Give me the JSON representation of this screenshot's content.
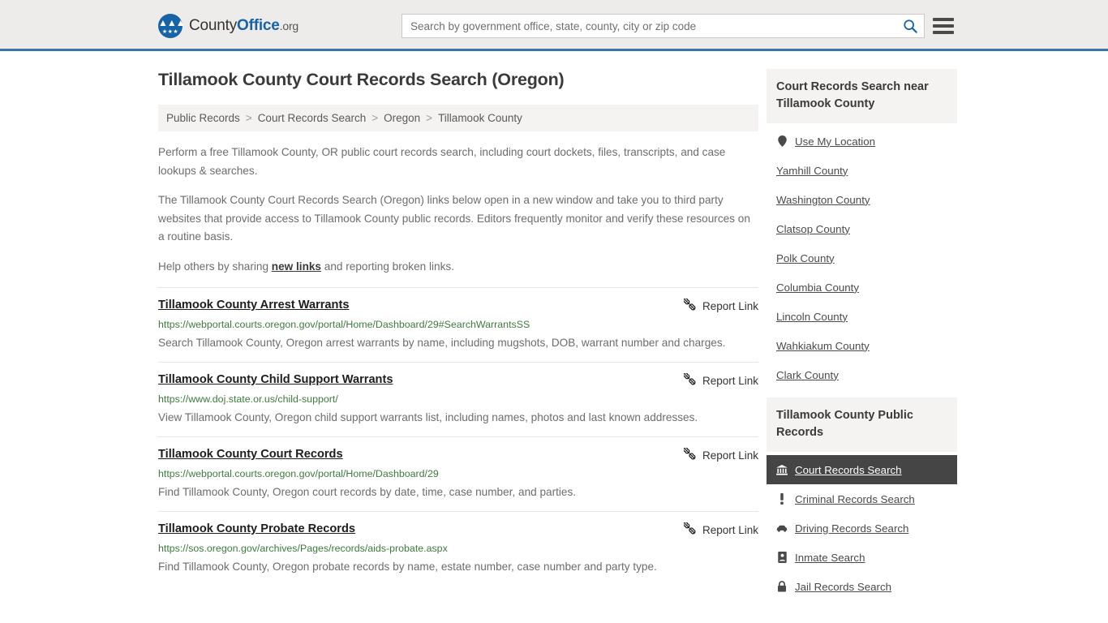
{
  "header": {
    "brand": {
      "part1": "County",
      "part2": "Office",
      "tld": ".org",
      "logo_icon": "eagle-seal-icon"
    },
    "search": {
      "placeholder": "Search by government office, state, county, city or zip code",
      "value": ""
    },
    "search_button_icon": "search-icon",
    "menu_button_icon": "hamburger-menu-icon",
    "accent_color": "#1763a8",
    "border_color": "#3a76a8"
  },
  "page_title": "Tillamook County Court Records Search (Oregon)",
  "breadcrumb": [
    "Public Records",
    "Court Records Search",
    "Oregon",
    "Tillamook County"
  ],
  "breadcrumb_separator": ">",
  "intro": {
    "p1": "Perform a free Tillamook County, OR public court records search, including court dockets, files, transcripts, and case lookups & searches.",
    "p2": "The Tillamook County Court Records Search (Oregon) links below open in a new window and take you to third party websites that provide access to Tillamook County public records. Editors frequently monitor and verify these resources on a routine basis.",
    "p3_before": "Help others by sharing ",
    "p3_link": "new links",
    "p3_after": " and reporting broken links."
  },
  "report_link_label": "Report Link",
  "report_link_icon": "broken-link-icon",
  "results": [
    {
      "title": "Tillamook County Arrest Warrants",
      "url": "https://webportal.courts.oregon.gov/portal/Home/Dashboard/29#SearchWarrantsSS",
      "description": "Search Tillamook County, Oregon arrest warrants by name, including mugshots, DOB, warrant number and charges."
    },
    {
      "title": "Tillamook County Child Support Warrants",
      "url": "https://www.doj.state.or.us/child-support/",
      "description": "View Tillamook County, Oregon child support warrants list, including names, photos and last known addresses."
    },
    {
      "title": "Tillamook County Court Records",
      "url": "https://webportal.courts.oregon.gov/portal/Home/Dashboard/29",
      "description": "Find Tillamook County, Oregon court records by date, time, case number, and parties."
    },
    {
      "title": "Tillamook County Probate Records",
      "url": "https://sos.oregon.gov/archives/Pages/records/aids-probate.aspx",
      "description": "Find Tillamook County, Oregon probate records by name, estate number, case number and party type."
    }
  ],
  "sidebar": {
    "nearby": {
      "heading": "Court Records Search near Tillamook County",
      "items": [
        {
          "label": "Use My Location",
          "icon": "map-pin-icon"
        },
        {
          "label": "Yamhill County",
          "icon": ""
        },
        {
          "label": "Washington County",
          "icon": ""
        },
        {
          "label": "Clatsop County",
          "icon": ""
        },
        {
          "label": "Polk County",
          "icon": ""
        },
        {
          "label": "Columbia County",
          "icon": ""
        },
        {
          "label": "Lincoln County",
          "icon": ""
        },
        {
          "label": "Wahkiakum County",
          "icon": ""
        },
        {
          "label": "Clark County",
          "icon": ""
        }
      ]
    },
    "public_records": {
      "heading": "Tillamook County Public Records",
      "items": [
        {
          "label": "Court Records Search",
          "icon": "courthouse-icon",
          "active": true
        },
        {
          "label": "Criminal Records Search",
          "icon": "exclamation-icon",
          "active": false
        },
        {
          "label": "Driving Records Search",
          "icon": "car-icon",
          "active": false
        },
        {
          "label": "Inmate Search",
          "icon": "id-card-icon",
          "active": false
        },
        {
          "label": "Jail Records Search",
          "icon": "lock-icon",
          "active": false
        }
      ]
    }
  }
}
